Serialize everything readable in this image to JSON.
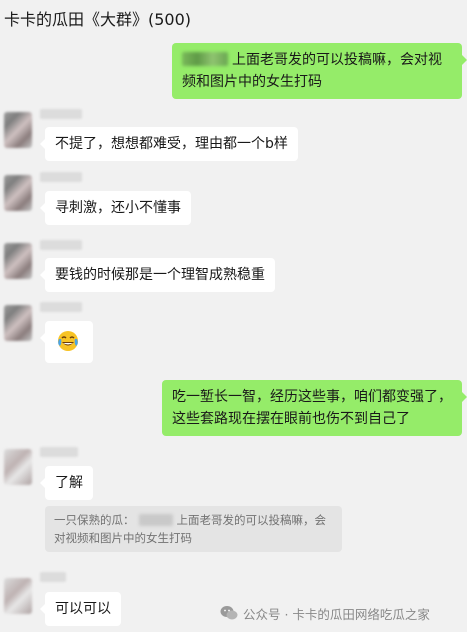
{
  "header": {
    "title": "卡卡的瓜田《大群》(500)"
  },
  "messages": [
    {
      "side": "right",
      "text": "上面老哥发的可以投稿嘛，会对视频和图片中的女生打码"
    },
    {
      "side": "left",
      "text": "不提了，想想都难受，理由都一个b样"
    },
    {
      "side": "left",
      "text": "寻刺激，还小不懂事"
    },
    {
      "side": "left",
      "text": "要钱的时候那是一个理智成熟稳重"
    },
    {
      "side": "left",
      "emoji": "crying-laughing-face"
    },
    {
      "side": "right",
      "text": "吃一堑长一智，经历这些事，咱们都变强了，这些套路现在摆在眼前也伤不到自己了"
    },
    {
      "side": "left",
      "text": "了解"
    },
    {
      "side": "left",
      "text": "可以可以"
    }
  ],
  "quote": {
    "sender": "一只保熟的瓜：",
    "text": "上面老哥发的可以投稿嘛，会对视频和图片中的女生打码"
  },
  "watermark": {
    "text": "公众号 · 卡卡的瓜田网络吃瓜之家"
  },
  "colors": {
    "background": "#f1f1f1",
    "bubble_green": "#95ec69",
    "bubble_white": "#ffffff"
  }
}
